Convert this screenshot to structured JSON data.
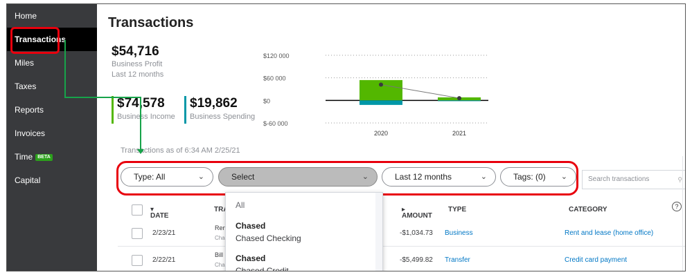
{
  "sidebar": {
    "items": [
      {
        "label": "Home"
      },
      {
        "label": "Transactions"
      },
      {
        "label": "Miles"
      },
      {
        "label": "Taxes"
      },
      {
        "label": "Reports"
      },
      {
        "label": "Invoices"
      },
      {
        "label": "Time",
        "badge": "BETA"
      },
      {
        "label": "Capital"
      }
    ],
    "active": "Transactions"
  },
  "page": {
    "title": "Transactions"
  },
  "summary": {
    "profit_value": "$54,716",
    "profit_label": "Business Profit",
    "profit_period": "Last 12 months",
    "income_value": "$74,578",
    "income_label": "Business Income",
    "spending_value": "$19,862",
    "spending_label": "Business Spending"
  },
  "chart_data": {
    "type": "bar",
    "categories": [
      "2020",
      "2021"
    ],
    "series": [
      {
        "values": [
          54000,
          8000
        ],
        "color": "#53b700"
      },
      {
        "values": [
          -12000,
          -2000
        ],
        "color": "#0097a7"
      },
      {
        "values": [
          42000,
          6000
        ],
        "color": "#393a3d"
      }
    ],
    "ytick_labels": [
      "$120 000",
      "$60 000",
      "$0",
      "$-60 000"
    ],
    "ylim": [
      -60000,
      120000
    ],
    "grid": true
  },
  "as_of": "Transactions as of 6:34 AM 2/25/21",
  "filters": {
    "type": "Type: All",
    "account": "Select",
    "period": "Last 12 months",
    "tags": "Tags: (0)",
    "search_placeholder": "Search transactions"
  },
  "table": {
    "headers": {
      "date": "DATE",
      "transaction": "TRA",
      "amount": "AMOUNT",
      "type": "TYPE",
      "category": "CATEGORY"
    },
    "rows": [
      {
        "date": "2/23/21",
        "desc1": "Ren",
        "desc2": "Cha",
        "amount": "-$1,034.73",
        "type": "Business",
        "category": "Rent and lease (home office)"
      },
      {
        "date": "2/22/21",
        "desc1": "Bill",
        "desc2": "Cha",
        "amount": "-$5,499.82",
        "type": "Transfer",
        "category": "Credit card payment"
      }
    ]
  },
  "dropdown": {
    "items": [
      {
        "label": "All",
        "kind": "option"
      },
      {
        "label": "Chased",
        "kind": "group"
      },
      {
        "label": "Chased Checking",
        "kind": "option"
      },
      {
        "label": "Chased",
        "kind": "group"
      },
      {
        "label": "Chased Credit",
        "kind": "option"
      }
    ]
  },
  "colors": {
    "accent": "#53b700",
    "spending": "#0097a7",
    "highlight": "#e8000d",
    "link": "#0077c5",
    "arrow": "#17a34a"
  }
}
